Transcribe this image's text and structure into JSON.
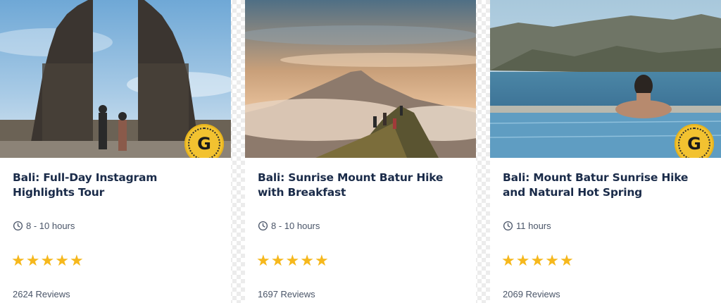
{
  "cards": [
    {
      "title": "Bali: Full-Day Instagram Highlights Tour",
      "duration": "8 - 10 hours",
      "rating": 5,
      "reviews": "2624 Reviews",
      "badge": "G"
    },
    {
      "title": "Bali: Sunrise Mount Batur Hike with Breakfast",
      "duration": "8 - 10 hours",
      "rating": 5,
      "reviews": "1697 Reviews"
    },
    {
      "title": "Bali: Mount Batur Sunrise Hike and Natural Hot Spring",
      "duration": "11 hours",
      "rating": 5,
      "reviews": "2069 Reviews",
      "badge": "G"
    }
  ],
  "icons": {
    "duration": "clock-icon",
    "rating": "star-icon",
    "badge": "getyourguide-original-badge-icon"
  },
  "colors": {
    "title": "#1a2b49",
    "star": "#f6b81c",
    "badge": "#f2c230",
    "meta_text": "#4a5568"
  }
}
